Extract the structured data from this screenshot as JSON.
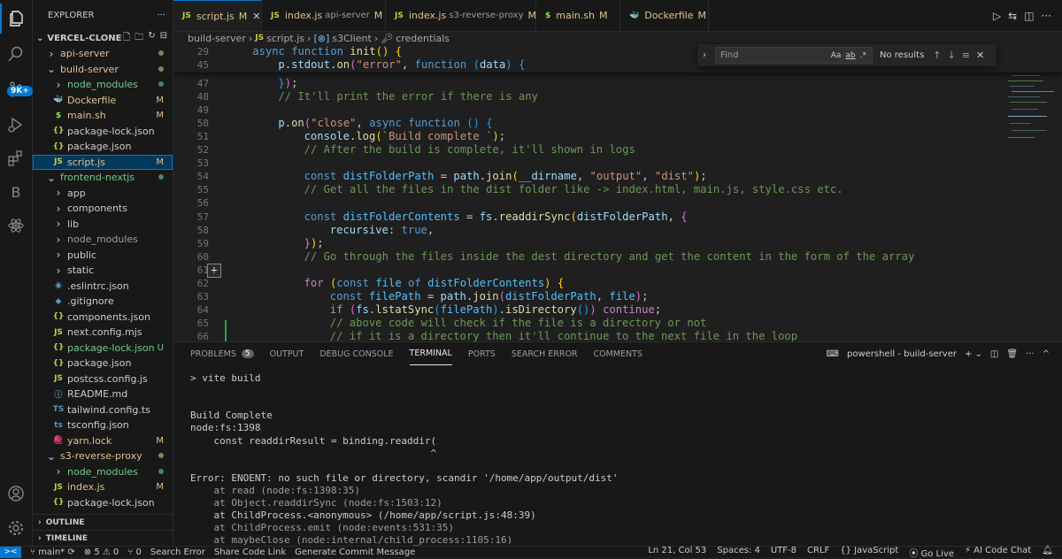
{
  "activity": {
    "badge": "9K+",
    "letter_b": "B"
  },
  "sidebar": {
    "title": "EXPLORER",
    "more": "···",
    "project": "VERCEL-CLONE",
    "tree": [
      {
        "label": "api-server",
        "indent": 1,
        "chev": "›",
        "status": "dot",
        "color": "#e2c08d"
      },
      {
        "label": "build-server",
        "indent": 1,
        "chev": "⌄",
        "status": "dot",
        "color": "#e2c08d"
      },
      {
        "label": "node_modules",
        "indent": 2,
        "chev": "›",
        "status": "dot",
        "color": "#73c991"
      },
      {
        "label": "Dockerfile",
        "indent": 2,
        "icon": "🐳",
        "iconClass": "docker",
        "status": "M",
        "color": "#e2c08d"
      },
      {
        "label": "main.sh",
        "indent": 2,
        "icon": "$",
        "iconClass": "sh",
        "status": "M",
        "color": "#e2c08d"
      },
      {
        "label": "package-lock.json",
        "indent": 2,
        "icon": "{}",
        "iconClass": "json",
        "status": "",
        "color": "#cccccc"
      },
      {
        "label": "package.json",
        "indent": 2,
        "icon": "{}",
        "iconClass": "json",
        "status": "",
        "color": "#cccccc"
      },
      {
        "label": "script.js",
        "indent": 2,
        "icon": "JS",
        "iconClass": "js",
        "status": "M",
        "color": "#e2c08d",
        "selected": true
      },
      {
        "label": "frontend-nextjs",
        "indent": 1,
        "chev": "⌄",
        "status": "dot",
        "color": "#73c991"
      },
      {
        "label": "app",
        "indent": 2,
        "chev": "›",
        "status": "",
        "color": "#cccccc"
      },
      {
        "label": "components",
        "indent": 2,
        "chev": "›",
        "status": "",
        "color": "#cccccc"
      },
      {
        "label": "lib",
        "indent": 2,
        "chev": "›",
        "status": "",
        "color": "#cccccc"
      },
      {
        "label": "node_modules",
        "indent": 2,
        "chev": "›",
        "status": "",
        "color": "#9d9d9d"
      },
      {
        "label": "public",
        "indent": 2,
        "chev": "›",
        "status": "",
        "color": "#cccccc"
      },
      {
        "label": "static",
        "indent": 2,
        "chev": "›",
        "status": "",
        "color": "#cccccc"
      },
      {
        "label": ".eslintrc.json",
        "indent": 2,
        "icon": "◉",
        "iconClass": "ts",
        "status": "",
        "color": "#cccccc"
      },
      {
        "label": ".gitignore",
        "indent": 2,
        "icon": "◆",
        "iconClass": "docker",
        "status": "",
        "color": "#cccccc"
      },
      {
        "label": "components.json",
        "indent": 2,
        "icon": "{}",
        "iconClass": "json",
        "status": "",
        "color": "#cccccc"
      },
      {
        "label": "next.config.mjs",
        "indent": 2,
        "icon": "JS",
        "iconClass": "js",
        "status": "",
        "color": "#cccccc"
      },
      {
        "label": "package-lock.json",
        "indent": 2,
        "icon": "{}",
        "iconClass": "json",
        "status": "U",
        "color": "#73c991"
      },
      {
        "label": "package.json",
        "indent": 2,
        "icon": "{}",
        "iconClass": "json",
        "status": "",
        "color": "#cccccc"
      },
      {
        "label": "postcss.config.js",
        "indent": 2,
        "icon": "JS",
        "iconClass": "js",
        "status": "",
        "color": "#cccccc"
      },
      {
        "label": "README.md",
        "indent": 2,
        "icon": "ⓘ",
        "iconClass": "ts",
        "status": "",
        "color": "#cccccc"
      },
      {
        "label": "tailwind.config.ts",
        "indent": 2,
        "icon": "TS",
        "iconClass": "ts",
        "status": "",
        "color": "#cccccc"
      },
      {
        "label": "tsconfig.json",
        "indent": 2,
        "icon": "ts",
        "iconClass": "ts",
        "status": "",
        "color": "#cccccc"
      },
      {
        "label": "yarn.lock",
        "indent": 2,
        "icon": "🧶",
        "iconClass": "docker",
        "status": "M",
        "color": "#e2c08d"
      },
      {
        "label": "s3-reverse-proxy",
        "indent": 1,
        "chev": "⌄",
        "status": "dot",
        "color": "#e2c08d"
      },
      {
        "label": "node_modules",
        "indent": 2,
        "chev": "›",
        "status": "dot",
        "color": "#73c991"
      },
      {
        "label": "index.js",
        "indent": 2,
        "icon": "JS",
        "iconClass": "js",
        "status": "M",
        "color": "#e2c08d"
      },
      {
        "label": "package-lock.json",
        "indent": 2,
        "icon": "{}",
        "iconClass": "json",
        "status": "",
        "color": "#cccccc"
      }
    ],
    "outline": "OUTLINE",
    "timeline": "TIMELINE"
  },
  "tabs": [
    {
      "icon": "JS",
      "name": "script.js",
      "mark": "M",
      "sub": "",
      "active": true,
      "close": "✕"
    },
    {
      "icon": "JS",
      "name": "index.js",
      "mark": "M",
      "sub": "api-server",
      "active": false
    },
    {
      "icon": "JS",
      "name": "index.js",
      "mark": "M",
      "sub": "s3-reverse-proxy",
      "active": false
    },
    {
      "icon": "$",
      "name": "main.sh",
      "mark": "M",
      "sub": "",
      "active": false
    },
    {
      "icon": "🐳",
      "name": "Dockerfile",
      "mark": "M",
      "sub": "",
      "active": false
    }
  ],
  "breadcrumbs": {
    "folder": "build-server",
    "file": "script.js",
    "symbol1": "s3Client",
    "symbol2": "credentials"
  },
  "find": {
    "placeholder": "Find",
    "opt1": "Aa",
    "opt2": "ab",
    "opt3": ".*",
    "result": "No results"
  },
  "editor": {
    "sticky": [
      {
        "n": "29",
        "html": "<span class='kw'>async</span> <span class='kw'>function</span> <span class='fn'>init</span><span class='pn'>()</span> <span class='pn'>{</span>",
        "indent": 4
      },
      {
        "n": "45",
        "html": "<span class='var'>p</span>.<span class='var'>stdout</span>.<span class='fn'>on</span><span class='pn2'>(</span><span class='str'>\"error\"</span>, <span class='kw'>function</span> <span class='pn3'>(</span><span class='var'>data</span><span class='pn3'>)</span> <span class='pn3'>{</span>",
        "indent": 8
      }
    ],
    "lines": [
      {
        "n": "47",
        "html": "<span class='pn3'>}</span><span class='pn2'>)</span>;",
        "indent": 8
      },
      {
        "n": "48",
        "html": "<span class='cm'>// It'll print the error if there is any</span>",
        "indent": 8
      },
      {
        "n": "49",
        "html": "",
        "indent": 0
      },
      {
        "n": "50",
        "html": "<span class='var'>p</span>.<span class='fn'>on</span><span class='pn2'>(</span><span class='str'>\"close\"</span>, <span class='kw'>async</span> <span class='kw'>function</span> <span class='pn3'>()</span> <span class='pn3'>{</span>",
        "indent": 8
      },
      {
        "n": "51",
        "html": "<span class='var'>console</span>.<span class='fn'>log</span><span class='pn'>(</span><span class='str'>`Build complete `</span><span class='pn'>)</span>;",
        "indent": 12
      },
      {
        "n": "52",
        "html": "<span class='cm'>// After the build is complete, it'll shown in logs</span>",
        "indent": 12
      },
      {
        "n": "53",
        "html": "",
        "indent": 0
      },
      {
        "n": "54",
        "html": "<span class='kw'>const</span> <span class='cst'>distFolderPath</span> = <span class='var'>path</span>.<span class='fn'>join</span><span class='pn'>(</span><span class='var'>__dirname</span>, <span class='str'>\"output\"</span>, <span class='str'>\"dist\"</span><span class='pn'>)</span>;",
        "indent": 12
      },
      {
        "n": "55",
        "html": "<span class='cm'>// Get all the files in the dist folder like -&gt; index.html, main.js, style.css etc.</span>",
        "indent": 12
      },
      {
        "n": "56",
        "html": "",
        "indent": 0
      },
      {
        "n": "57",
        "html": "<span class='kw'>const</span> <span class='cst'>distFolderContents</span> = <span class='var'>fs</span>.<span class='fn'>readdirSync</span><span class='pn'>(</span><span class='var'>distFolderPath</span>, <span class='pn2'>{</span>",
        "indent": 12
      },
      {
        "n": "58",
        "html": "<span class='var'>recursive</span>: <span class='kw'>true</span>,",
        "indent": 16
      },
      {
        "n": "59",
        "html": "<span class='pn2'>}</span><span class='pn'>)</span>;",
        "indent": 12
      },
      {
        "n": "60",
        "html": "<span class='cm'>// Go through the files inside the dest directory and get the content in the form of the array</span>",
        "indent": 12
      },
      {
        "n": "61",
        "html": "",
        "indent": 0
      },
      {
        "n": "62",
        "html": "<span class='ctl'>for</span> <span class='pn'>(</span><span class='kw'>const</span> <span class='cst'>file</span> <span class='kw'>of</span> <span class='cst'>distFolderContents</span><span class='pn'>)</span> <span class='pn'>{</span>",
        "indent": 12
      },
      {
        "n": "63",
        "html": "<span class='kw'>const</span> <span class='cst'>filePath</span> = <span class='var'>path</span>.<span class='fn'>join</span><span class='pn2'>(</span><span class='cst'>distFolderPath</span>, <span class='cst'>file</span><span class='pn2'>)</span>;",
        "indent": 16
      },
      {
        "n": "64",
        "html": "<span class='ctl'>if</span> <span class='pn2'>(</span><span class='var'>fs</span>.<span class='fn'>lstatSync</span><span class='pn3'>(</span><span class='cst'>filePath</span><span class='pn3'>)</span>.<span class='fn'>isDirectory</span><span class='pn3'>()</span><span class='pn2'>)</span> <span class='ctl'>continue</span>;",
        "indent": 16
      },
      {
        "n": "65",
        "html": "<span class='cm'>// above code will check if the file is a directory or not</span>",
        "indent": 16
      },
      {
        "n": "66",
        "html": "<span class='cm'>// if it is a directory then it'll continue to the next file in the loop</span>",
        "indent": 16
      }
    ]
  },
  "panel": {
    "tabs": [
      {
        "label": "PROBLEMS",
        "badge": "5"
      },
      {
        "label": "OUTPUT"
      },
      {
        "label": "DEBUG CONSOLE"
      },
      {
        "label": "TERMINAL",
        "active": true
      },
      {
        "label": "PORTS"
      },
      {
        "label": "SEARCH ERROR"
      },
      {
        "label": "COMMENTS"
      }
    ],
    "shell": "powershell - build-server",
    "terminal": [
      {
        "t": "> vite build",
        "c": "#cccccc"
      },
      {
        "t": "",
        "c": "#cccccc"
      },
      {
        "t": "",
        "c": "#cccccc"
      },
      {
        "t": "Build Complete",
        "c": "#cccccc"
      },
      {
        "t": "node:fs:1398",
        "c": "#cccccc"
      },
      {
        "t": "    const readdirResult = binding.readdir(",
        "c": "#cccccc"
      },
      {
        "t": "                                         ^",
        "c": "#cccccc"
      },
      {
        "t": "",
        "c": "#cccccc"
      },
      {
        "t": "Error: ENOENT: no such file or directory, scandir '/home/app/output/dist'",
        "c": "#cccccc"
      },
      {
        "t": "    at read (node:fs:1398:35)",
        "c": "#9d9d9d"
      },
      {
        "t": "    at Object.readdirSync (node:fs:1503:12)",
        "c": "#9d9d9d"
      },
      {
        "t": "    at ChildProcess.<anonymous> (/home/app/script.js:48:39)",
        "c": "#cccccc"
      },
      {
        "t": "    at ChildProcess.emit (node:events:531:35)",
        "c": "#9d9d9d"
      },
      {
        "t": "    at maybeClose (node:internal/child_process:1105:16)",
        "c": "#9d9d9d"
      }
    ]
  },
  "status": {
    "remote": "><",
    "branch": "main*",
    "errors": "⊗ 5 ⚠ 0",
    "ports": "⑂ 0",
    "search_error": "Search Error",
    "share": "Share Code Link",
    "generate": "Generate Commit Message",
    "position": "Ln 21, Col 53",
    "spaces": "Spaces: 4",
    "encoding": "UTF-8",
    "eol": "CRLF",
    "language": "{} JavaScript",
    "golive": "Go Live",
    "ai": "AI Code Chat"
  }
}
